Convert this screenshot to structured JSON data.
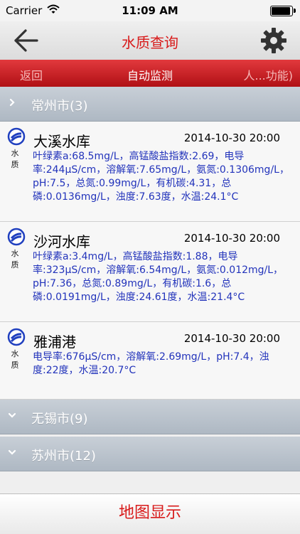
{
  "status_bar": {
    "carrier": "Carrier",
    "time": "11:09 AM"
  },
  "nav": {
    "title": "水质查询"
  },
  "tabs": {
    "left": "返回",
    "center": "自动监测",
    "right": "人...功能)"
  },
  "groups": [
    {
      "label": "常州市(3)",
      "expanded": true
    },
    {
      "label": "无锡市(9)",
      "expanded": false
    },
    {
      "label": "苏州市(12)",
      "expanded": false
    }
  ],
  "stations": [
    {
      "tag": "水 质",
      "name": "大溪水库",
      "date": "2014-10-30 20:00",
      "desc": "叶绿素a:68.5mg/L，高锰酸盐指数:2.69，电导率:244μS/cm，溶解氧:7.65mg/L，氨氮:0.1306mg/L，pH:7.5，总氮:0.99mg/L，有机碳:4.31，总磷:0.0136mg/L，浊度:7.63度，水温:24.1°C"
    },
    {
      "tag": "水 质",
      "name": "沙河水库",
      "date": "2014-10-30 20:00",
      "desc": "叶绿素a:3.4mg/L，高锰酸盐指数:1.88，电导率:323μS/cm，溶解氧:6.54mg/L，氨氮:0.012mg/L，pH:7.36，总氮:0.89mg/L，有机碳:1.6，总磷:0.0191mg/L，浊度:24.61度，水温:21.4°C"
    },
    {
      "tag": "水 质",
      "name": "雅浦港",
      "date": "2014-10-30 20:00",
      "desc": "电导率:676μS/cm，溶解氧:2.69mg/L，pH:7.4，浊度:22度，水温:20.7°C"
    }
  ],
  "footer": {
    "map_button": "地图显示"
  },
  "colors": {
    "accent": "#d81a1a",
    "tab_bar": "#c8181d",
    "desc_text": "#2233bb"
  }
}
